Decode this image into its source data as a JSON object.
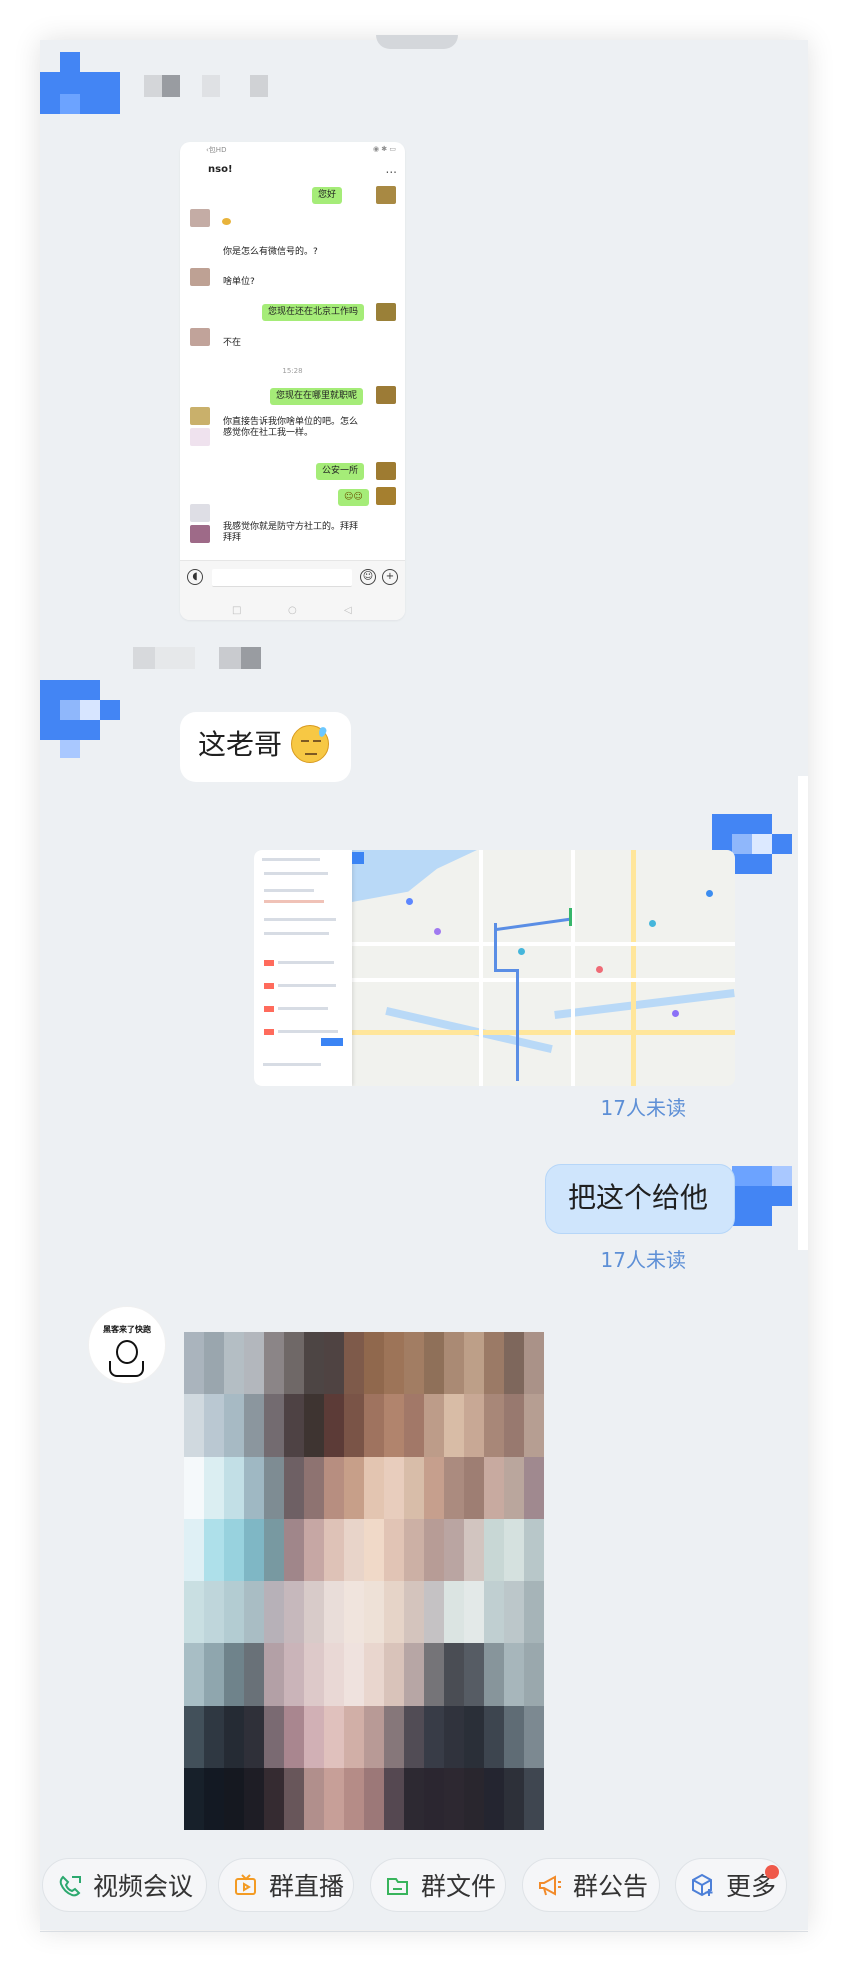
{
  "conversation": {
    "messages": [
      {
        "type": "screenshot",
        "screenshot": {
          "status_left": "‹包HD",
          "status_right": "◉ ✱ ▭",
          "title": "nso!",
          "menu": "...",
          "messages": [
            {
              "text": "您好",
              "side": "right"
            },
            {
              "text": "",
              "side": "left"
            },
            {
              "text": "你是怎么有微信号的。?",
              "side": "left"
            },
            {
              "text": "啥单位?",
              "side": "left"
            },
            {
              "text": "您现在还在北京工作吗",
              "side": "right"
            },
            {
              "text": "不在",
              "side": "left"
            },
            {
              "text": "15:28",
              "side": "center"
            },
            {
              "text": "您现在在哪里就职呢",
              "side": "right"
            },
            {
              "text": "你直接告诉我你啥单位的吧。怎么",
              "side": "left"
            },
            {
              "text": "感觉你在社工我一样。",
              "side": "left"
            },
            {
              "text": "公安一所",
              "side": "right"
            },
            {
              "text": "☺☺",
              "side": "right"
            },
            {
              "text": "我感觉你就是防守方社工的。拜拜",
              "side": "left"
            },
            {
              "text": "拜拜",
              "side": "left"
            }
          ]
        }
      },
      {
        "type": "text",
        "text": "这老哥",
        "emoji": "sweating-face"
      },
      {
        "type": "image",
        "image": "map",
        "read_status": "17人未读"
      },
      {
        "type": "text",
        "text": "把这个给他",
        "read_status": "17人未读"
      },
      {
        "type": "image",
        "image": "pixelated-photo",
        "avatar_text": "黑客来了快跑"
      }
    ]
  },
  "toolbar": {
    "buttons": [
      {
        "label": "视频会议",
        "icon": "video-call-icon",
        "color": "#2ca96f"
      },
      {
        "label": "群直播",
        "icon": "group-live-icon",
        "color": "#f39b24"
      },
      {
        "label": "群文件",
        "icon": "group-files-icon",
        "color": "#38b45c"
      },
      {
        "label": "群公告",
        "icon": "announcement-icon",
        "color": "#f28b2a"
      },
      {
        "label": "更多",
        "icon": "more-apps-icon",
        "color": "#4d80d8"
      }
    ],
    "notification": true
  },
  "colors": {
    "chat_background": "#edf0f3",
    "self_bubble": "#cfe5fc",
    "unread_text": "#5d8fd6",
    "avatar_blue": "#4385f4",
    "notification": "#ef594a"
  }
}
